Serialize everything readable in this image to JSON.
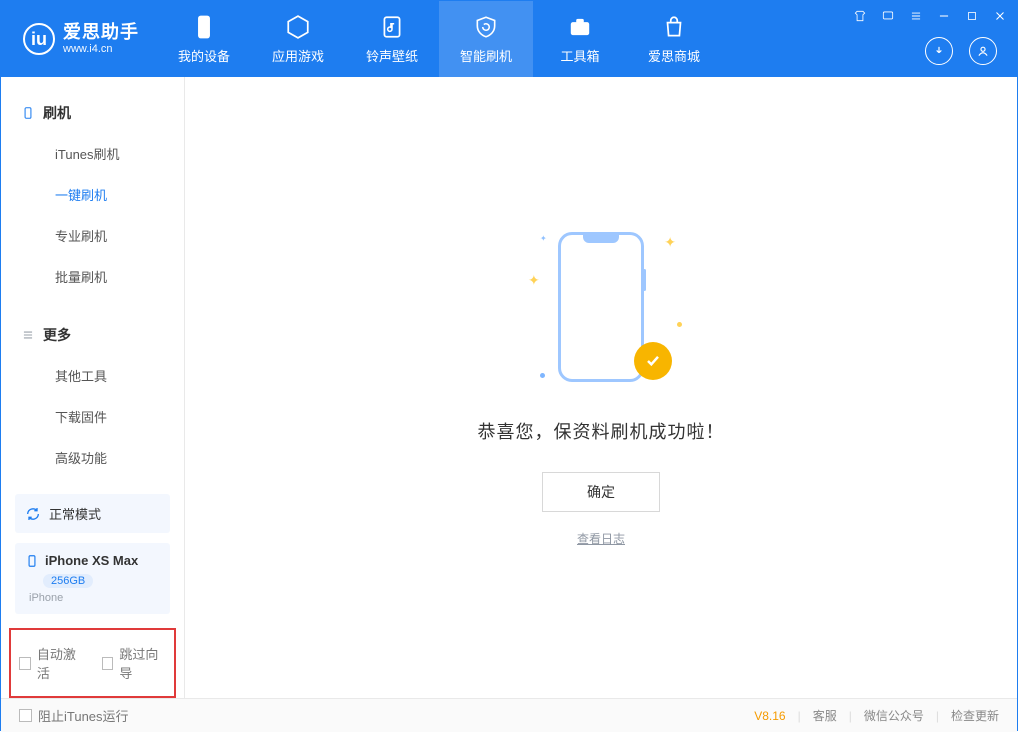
{
  "app": {
    "name": "爱思助手",
    "site": "www.i4.cn"
  },
  "tabs": [
    {
      "id": "device",
      "label": "我的设备"
    },
    {
      "id": "apps",
      "label": "应用游戏"
    },
    {
      "id": "ring",
      "label": "铃声壁纸"
    },
    {
      "id": "flash",
      "label": "智能刷机"
    },
    {
      "id": "tools",
      "label": "工具箱"
    },
    {
      "id": "store",
      "label": "爱思商城"
    }
  ],
  "activeTabIndex": 3,
  "sidebar": {
    "groups": [
      {
        "title": "刷机",
        "items": [
          "iTunes刷机",
          "一键刷机",
          "专业刷机",
          "批量刷机"
        ],
        "activeIndex": 1
      },
      {
        "title": "更多",
        "items": [
          "其他工具",
          "下载固件",
          "高级功能"
        ],
        "activeIndex": -1
      }
    ]
  },
  "mode": {
    "label": "正常模式"
  },
  "device": {
    "name": "iPhone XS Max",
    "storage": "256GB",
    "type": "iPhone"
  },
  "options": {
    "autoActivate": "自动激活",
    "skipGuide": "跳过向导"
  },
  "result": {
    "message": "恭喜您，保资料刷机成功啦！",
    "okLabel": "确定",
    "logLink": "查看日志"
  },
  "footer": {
    "blockItunes": "阻止iTunes运行",
    "version": "V8.16",
    "links": [
      "客服",
      "微信公众号",
      "检查更新"
    ]
  }
}
